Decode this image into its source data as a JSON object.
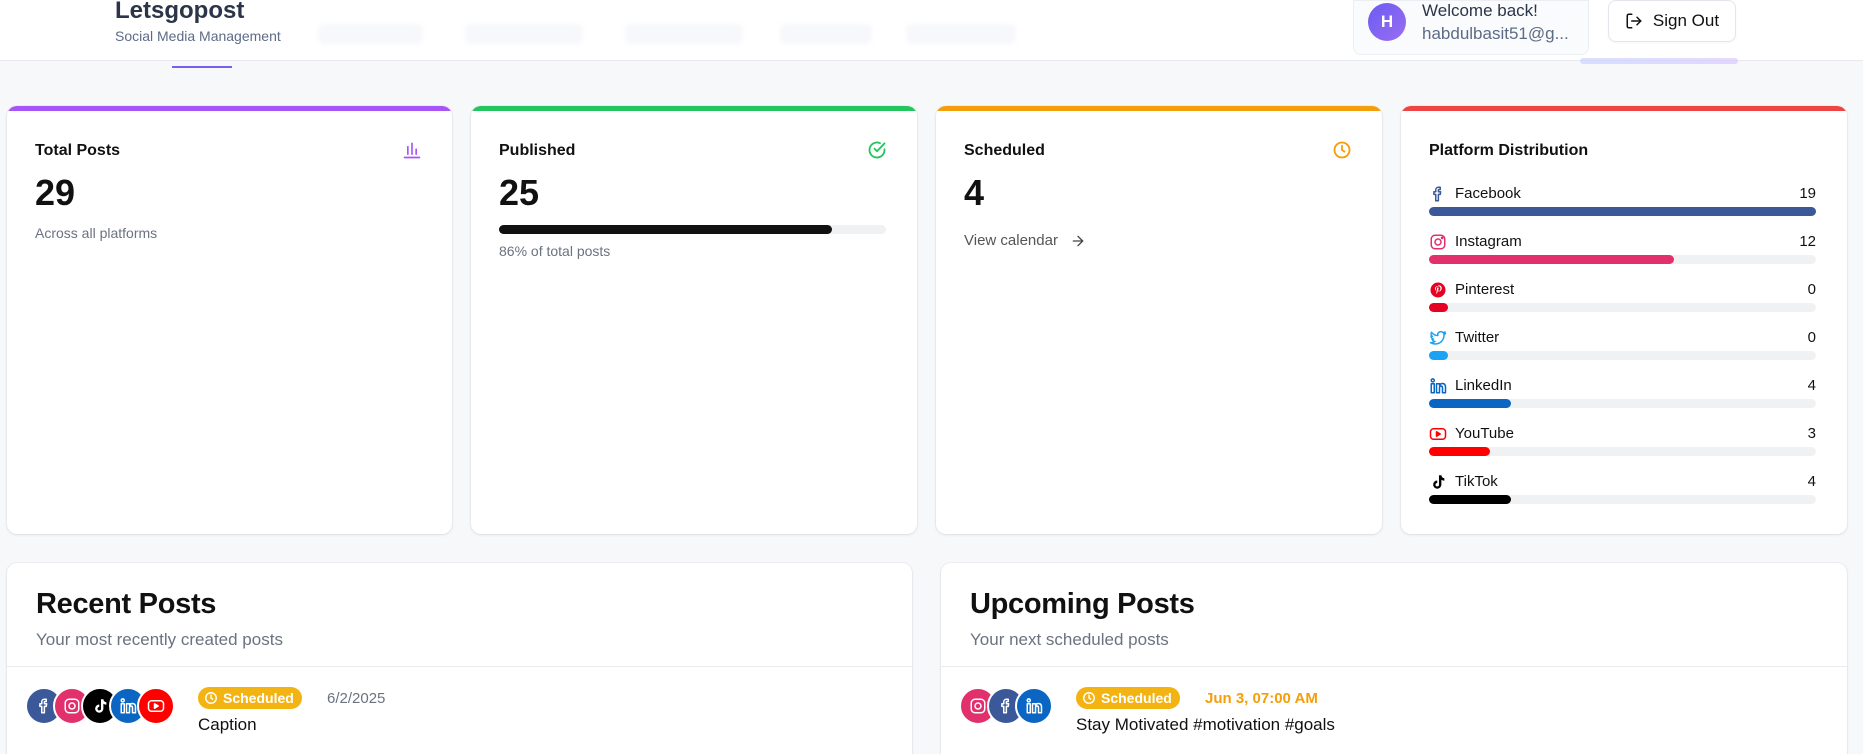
{
  "header": {
    "brand_name": "Letsgopost",
    "brand_sub": "Social Media Management",
    "user": {
      "initial": "H",
      "welcome": "Welcome back!",
      "email": "habdulbasit51@g..."
    },
    "signout_label": "Sign Out"
  },
  "stats": {
    "total": {
      "title": "Total Posts",
      "value": "29",
      "sub": "Across all platforms",
      "accent": "#a855f7",
      "icon": "bar-chart-icon"
    },
    "published": {
      "title": "Published",
      "value": "25",
      "sub": "86% of total posts",
      "progress_percent": 86,
      "accent": "#22c55e",
      "icon": "check-circle-icon"
    },
    "scheduled": {
      "title": "Scheduled",
      "value": "4",
      "link": "View calendar",
      "accent": "#f59e0b",
      "icon": "clock-icon"
    },
    "platforms": {
      "title": "Platform Distribution",
      "accent": "#ef4444",
      "items": [
        {
          "name": "Facebook",
          "count": "19",
          "fraction": 1.0,
          "color": "#3b5998",
          "icon": "facebook-icon"
        },
        {
          "name": "Instagram",
          "count": "12",
          "fraction": 0.632,
          "color": "#e1306c",
          "icon": "instagram-icon"
        },
        {
          "name": "Pinterest",
          "count": "0",
          "fraction": 0.0,
          "color": "#e60023",
          "icon": "pinterest-icon"
        },
        {
          "name": "Twitter",
          "count": "0",
          "fraction": 0.0,
          "color": "#1da1f2",
          "icon": "twitter-icon"
        },
        {
          "name": "LinkedIn",
          "count": "4",
          "fraction": 0.211,
          "color": "#0a66c2",
          "icon": "linkedin-icon"
        },
        {
          "name": "YouTube",
          "count": "3",
          "fraction": 0.158,
          "color": "#ff0000",
          "icon": "youtube-icon"
        },
        {
          "name": "TikTok",
          "count": "4",
          "fraction": 0.211,
          "color": "#000000",
          "icon": "tiktok-icon"
        }
      ]
    }
  },
  "recent": {
    "title": "Recent Posts",
    "sub": "Your most recently created posts",
    "post": {
      "status": "Scheduled",
      "date": "6/2/2025",
      "caption": "Caption"
    }
  },
  "upcoming": {
    "title": "Upcoming Posts",
    "sub": "Your next scheduled posts",
    "post": {
      "status": "Scheduled",
      "date": "Jun 3, 07:00 AM",
      "caption": "Stay Motivated #motivation #goals"
    }
  }
}
